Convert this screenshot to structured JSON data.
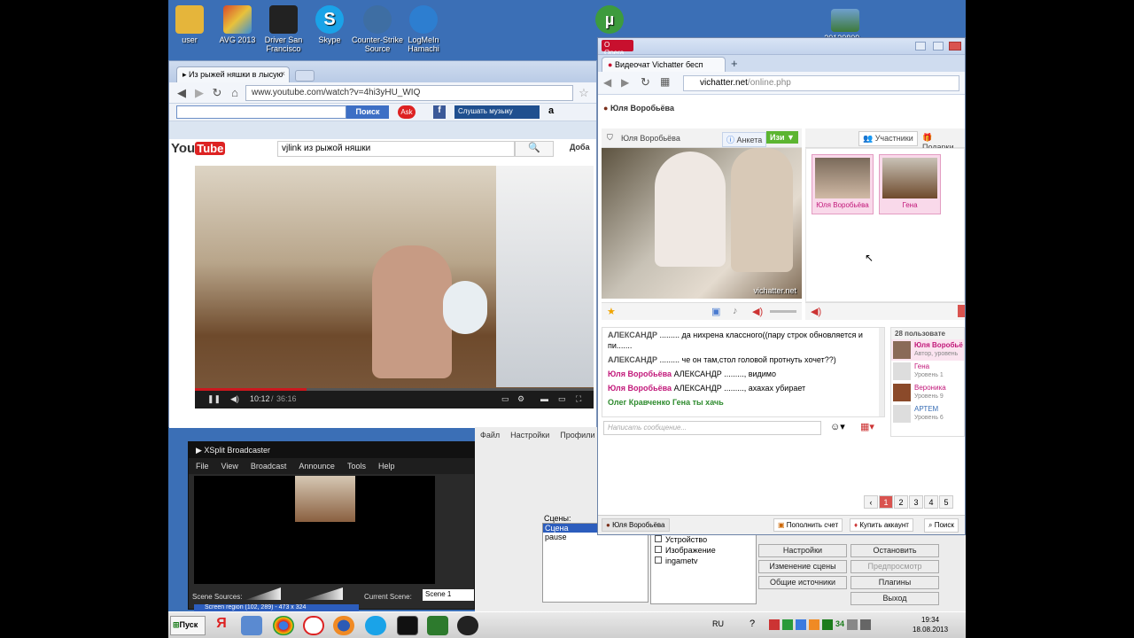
{
  "desktop_icons": [
    {
      "label": "user",
      "icon": "folder-icon",
      "color": "#e5b53b"
    },
    {
      "label": "AVG 2013",
      "icon": "avg-icon",
      "color": "#d84a2a"
    },
    {
      "label": "Driver San Francisco",
      "icon": "driver-icon",
      "color": "#222222"
    },
    {
      "label": "Skype",
      "icon": "skype-icon",
      "color": "#1aa3e8"
    },
    {
      "label": "Counter-Strike Source",
      "icon": "cs-icon",
      "color": "#3e6ea3"
    },
    {
      "label": "LogMeIn Hamachi",
      "icon": "hamachi-icon",
      "color": "#2d7ed0"
    },
    {
      "label": "",
      "icon": "utorrent-icon",
      "color": "#3d9b3d"
    },
    {
      "label": "20130809...",
      "icon": "image-file-icon",
      "color": "#6fa0cf"
    }
  ],
  "chrome": {
    "tab_title": "▸ Из рыжей няшки в лысую",
    "url": "www.youtube.com/watch?v=4hi3yHU_WIQ",
    "search_button": "Поиск",
    "music_button": "Слушать музыку",
    "youtube_search": "vjlink из рыжой няшки",
    "add_label": "Доба",
    "video_time": "10:12",
    "video_duration": "36:16",
    "progress": 0.28
  },
  "opera": {
    "title": "Opera",
    "tab_title": "Видеочат Vichatter бесп",
    "url_host": "vichatter.net",
    "url_path": "/online.php",
    "user_header": "Юля Воробьёва",
    "cam_user": "Юля Воробьёва",
    "profile_button": "Анкета",
    "action_button": "Изи ▼",
    "participants_tab": "Участники",
    "gifts_tab": "Подарки",
    "watermark": "vichatter.net",
    "thumbs": [
      {
        "name": "Юля Воробьёва"
      },
      {
        "name": "Гена"
      }
    ],
    "chat": [
      {
        "author": "АЛЕКСАНДР",
        "text": "......... да нихрена классного((пару строк обновляется и пи.......",
        "color": "#555555"
      },
      {
        "author": "АЛЕКСАНДР",
        "text": "......... че он там,стол головой протнуть хочет??)",
        "color": "#555555"
      },
      {
        "author": "Юля Воробьёва",
        "text": "АЛЕКСАНДР ........., видимо",
        "color": "#c2187a"
      },
      {
        "author": "Юля Воробьёва",
        "text": "АЛЕКСАНДР ........., ахахах убирает",
        "color": "#c2187a"
      },
      {
        "author": "Олег Кравченко",
        "text": "Гена ты хачь",
        "color": "#2e8b2e"
      }
    ],
    "message_placeholder": "Написать сообщение...",
    "users_count": "28 пользовате",
    "users": [
      {
        "name": "Юля Воробьё",
        "meta": "Автор, уровень"
      },
      {
        "name": "Гена",
        "meta": "Уровень 1"
      },
      {
        "name": "Вероника",
        "meta": "Уровень 9"
      },
      {
        "name": "АРТЕМ",
        "meta": "Уровень 6"
      }
    ],
    "pages": [
      "‹",
      "1",
      "2",
      "3",
      "4",
      "5"
    ],
    "bottom_user": "Юля Воробьёва",
    "bottom_buttons": [
      "Пополнить счет",
      "Купить аккаунт",
      "Поиск"
    ]
  },
  "obs": {
    "menu": [
      "Файл",
      "Настройки",
      "Профили"
    ],
    "scenes_label": "Сцены:",
    "scenes": [
      "Сцена",
      "pause"
    ],
    "sources": [
      "Устройство",
      "Изображение",
      "ingametv"
    ],
    "buttons": [
      "Настройки",
      "Остановить трансляцию",
      "Изменение сцены",
      "Предпросмотр",
      "Общие источники",
      "Плагины",
      "Выход"
    ]
  },
  "xsplit": {
    "title": "XSplit Broadcaster",
    "menu": [
      "File",
      "View",
      "Broadcast",
      "Announce",
      "Tools",
      "Help"
    ],
    "scene_sources": "Scene Sources:",
    "current_scene": "Current Scene:",
    "scene_value": "Scene 1",
    "source_row": "Screen region (102, 289) - 473 x 324"
  },
  "taskbar": {
    "start": "Пуск",
    "lang": "RU",
    "time": "19:34",
    "date": "18.08.2013",
    "tray_number": "34"
  }
}
